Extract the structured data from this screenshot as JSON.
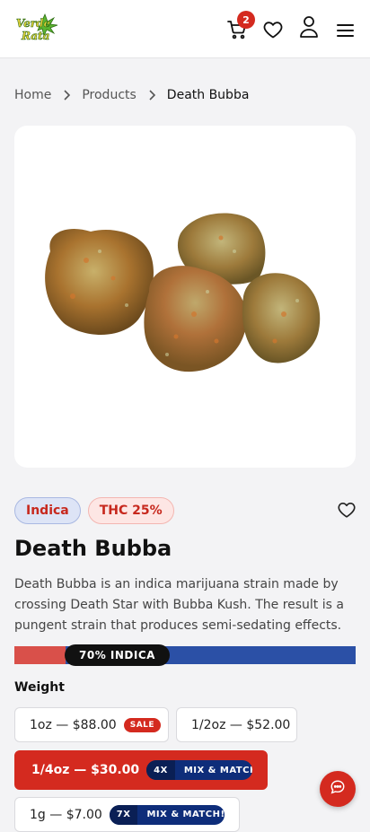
{
  "header": {
    "logo_line1": "Verde",
    "logo_line2": "Rata",
    "cart_count": "2"
  },
  "breadcrumb": {
    "items": [
      "Home",
      "Products",
      "Death Bubba"
    ]
  },
  "product": {
    "tags": [
      "Indica",
      "THC 25%"
    ],
    "title": "Death Bubba",
    "description": "Death Bubba is an indica marijuana strain made by crossing Death Star with Bubba Kush. The result is a pungent strain that produces semi-sedating effects.",
    "strain_meter": {
      "label": "70% INDICA",
      "indica_fraction": 0.15,
      "indica_color": "#d9504a",
      "sativa_color": "#2b50a6"
    },
    "weight_label": "Weight",
    "options": [
      {
        "label": "1oz — $88.00",
        "badge": "SALE"
      },
      {
        "label": "1/2oz — $52.00"
      },
      {
        "label": "1/4oz — $30.00",
        "mix_count": "4X",
        "mix_text": "MIX & MATCH!",
        "selected": true
      },
      {
        "label": "1g — $7.00",
        "mix_count": "7X",
        "mix_text": "MIX & MATCH!"
      }
    ]
  },
  "colors": {
    "accent": "#d42a1f",
    "navy": "#0e2d7a",
    "logo_green": "#2f8a1c",
    "logo_yellow": "#e9d43a"
  },
  "icons": [
    "cart-icon",
    "heart-icon",
    "user-icon",
    "menu-icon",
    "chevron-right-icon",
    "chat-icon"
  ]
}
